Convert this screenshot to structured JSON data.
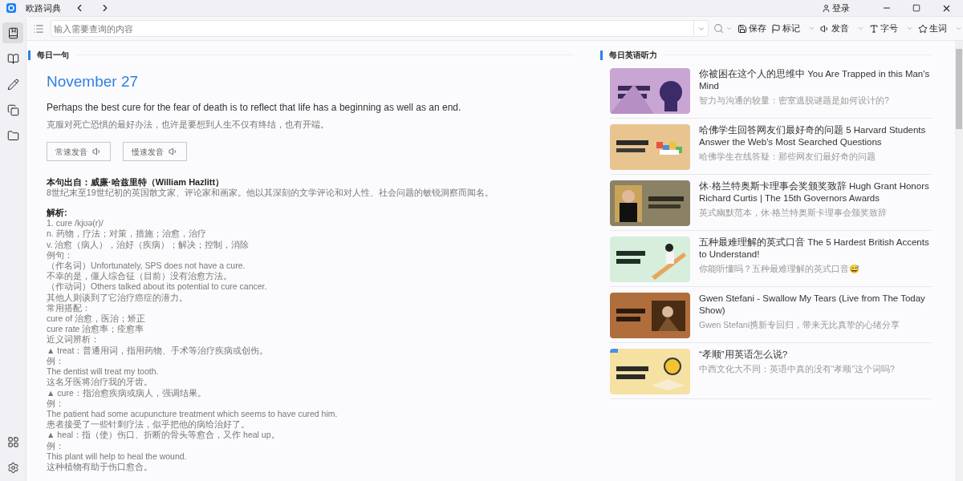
{
  "window": {
    "title": "欧路词典",
    "login": "登录"
  },
  "sidebar": {
    "items": [
      {
        "selected": true
      },
      {
        "selected": false
      },
      {
        "selected": false
      },
      {
        "selected": false
      },
      {
        "selected": false
      }
    ],
    "bottom_items": [
      {
        "selected": false
      },
      {
        "selected": false
      }
    ]
  },
  "search": {
    "placeholder": "输入需要查询的内容"
  },
  "toolbar": {
    "actions": [
      {
        "label": "保存",
        "has_menu": false
      },
      {
        "label": "标记",
        "has_menu": true
      },
      {
        "label": "发音",
        "has_menu": true
      },
      {
        "label": "字号",
        "has_menu": true
      },
      {
        "label": "生词",
        "has_menu": true
      }
    ]
  },
  "daily_sentence": {
    "section_title": "每日一句",
    "date": "November 27",
    "sentence": "Perhaps the best cure for the fear of death is to reflect that life has a beginning as well as an end.",
    "translation": "克服对死亡恐惧的最好办法，也许是要想到人生不仅有终结，也有开端。",
    "buttons": [
      "常速发音",
      "慢速发音"
    ],
    "source": "本句出自：威廉·哈兹里特（William Hazlitt）",
    "bio": "8世纪末至19世纪初的英国散文家、评论家和画家。他以其深刻的文学评论和对人性、社会问题的敏锐洞察而闻名。",
    "analysis_title": "解析:",
    "lines": [
      "1. cure /kjʊə(r)/",
      "n. 药物，疗法；对策，措施；治愈，治疗",
      "v. 治愈（病人），治好（疾病）；解决；控制，消除",
      "例句：",
      "（作名词）Unfortunately, SPS does not have a cure.",
      "不幸的是，僵人综合征（目前）没有治愈方法。",
      "（作动词）Others talked about its potential to cure cancer.",
      "其他人则谈到了它治疗癌症的潜力。",
      "常用搭配：",
      "cure of 治愈，医治；矫正",
      "cure rate 治愈率；痊愈率",
      "近义词辨析：",
      "▲ treat：普通用词，指用药物、手术等治疗疾病或创伤。",
      "例：",
      "The dentist will treat my tooth.",
      "这名牙医将治疗我的牙齿。",
      "▲ cure：指治愈疾病或病人，强调结果。",
      "例：",
      "The patient had some acupuncture treatment which seems to have cured him.",
      "患者接受了一些针刺疗法，似乎把他的病给治好了。",
      "▲ heal：指（使）伤口、折断的骨头等愈合，又作 heal up。",
      "例：",
      "This plant will help to heal the wound.",
      "这种植物有助于伤口愈合。"
    ]
  },
  "listening": {
    "section_title": "每日英语听力",
    "items": [
      {
        "title": "你被困在这个人的思维中 You Are Trapped in this Man's Mind",
        "subtitle": "智力与沟通的较量：密室逃脱谜题是如何设计的?"
      },
      {
        "title": "哈佛学生回答网友们最好奇的问题 5 Harvard Students Answer the Web's Most Searched Questions",
        "subtitle": "哈佛学生在线答疑：那些网友们最好奇的问题"
      },
      {
        "title": "休·格兰特奥斯卡理事会奖颁奖致辞 Hugh Grant Honors Richard Curtis | The 15th Governors Awards",
        "subtitle": "英式幽默范本，休·格兰特奥斯卡理事会颁奖致辞"
      },
      {
        "title": "五种最难理解的英式口音 The 5 Hardest British Accents to Understand!",
        "subtitle": "你能听懂吗？五种最难理解的英式口音😅"
      },
      {
        "title": "Gwen Stefani - Swallow My Tears (Live from The Today Show)",
        "subtitle": "Gwen Stefani携新专回归，带来无比真挚的心绪分享"
      },
      {
        "title": "“孝顺”用英语怎么说?",
        "subtitle": "中西文化大不同：英语中真的没有“孝顺”这个词吗?"
      }
    ]
  }
}
